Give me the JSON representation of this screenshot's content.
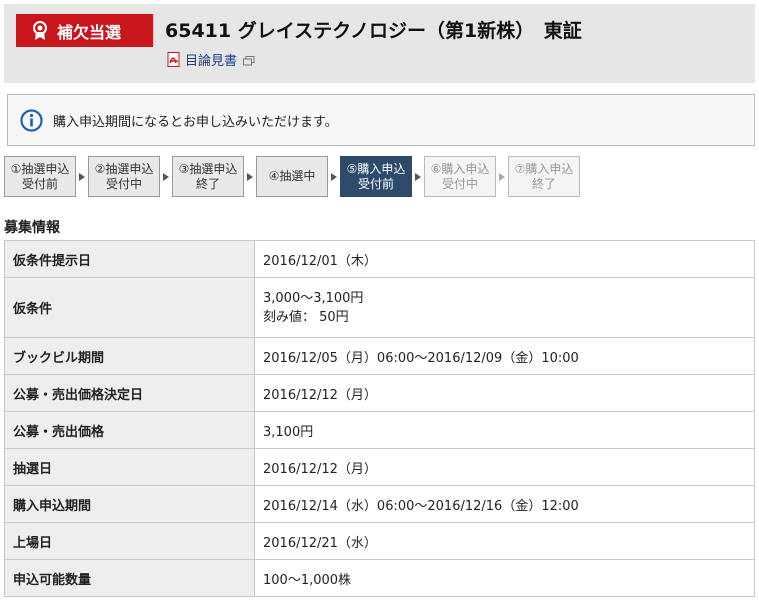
{
  "header": {
    "badge_label": "補欠当選",
    "title": "65411 グレイステクノロジー（第1新株）　東証",
    "doc_link_label": "目論見書"
  },
  "notice": {
    "text": "購入申込期間になるとお申し込みいただけます。"
  },
  "steps": [
    {
      "line1": "①抽選申込",
      "line2": "受付前",
      "state": "done"
    },
    {
      "line1": "②抽選申込",
      "line2": "受付中",
      "state": "done"
    },
    {
      "line1": "③抽選申込",
      "line2": "終了",
      "state": "done"
    },
    {
      "line1": "④抽選中",
      "line2": "",
      "state": "done"
    },
    {
      "line1": "⑤購入申込",
      "line2": "受付前",
      "state": "active"
    },
    {
      "line1": "⑥購入申込",
      "line2": "受付中",
      "state": "future"
    },
    {
      "line1": "⑦購入申込",
      "line2": "終了",
      "state": "future"
    }
  ],
  "section_title": "募集情報",
  "table": {
    "rows": [
      {
        "label": "仮条件提示日",
        "value": "2016/12/01（木）"
      },
      {
        "label": "仮条件",
        "value": "3,000～3,100円",
        "value2": "刻み値： 50円"
      },
      {
        "label": "ブックビル期間",
        "value": "2016/12/05（月）06:00～2016/12/09（金）10:00"
      },
      {
        "label": "公募・売出価格決定日",
        "value": "2016/12/12（月）"
      },
      {
        "label": "公募・売出価格",
        "value": "3,100円"
      },
      {
        "label": "抽選日",
        "value": "2016/12/12（月）"
      },
      {
        "label": "購入申込期間",
        "value": "2016/12/14（水）06:00～2016/12/16（金）12:00"
      },
      {
        "label": "上場日",
        "value": "2016/12/21（水）"
      },
      {
        "label": "申込可能数量",
        "value": "100～1,000株"
      }
    ]
  },
  "colors": {
    "badge_bg": "#c9161d",
    "active_step_bg": "#2d4a6a",
    "link": "#1a3d8f",
    "info_icon": "#1f5fb8"
  }
}
